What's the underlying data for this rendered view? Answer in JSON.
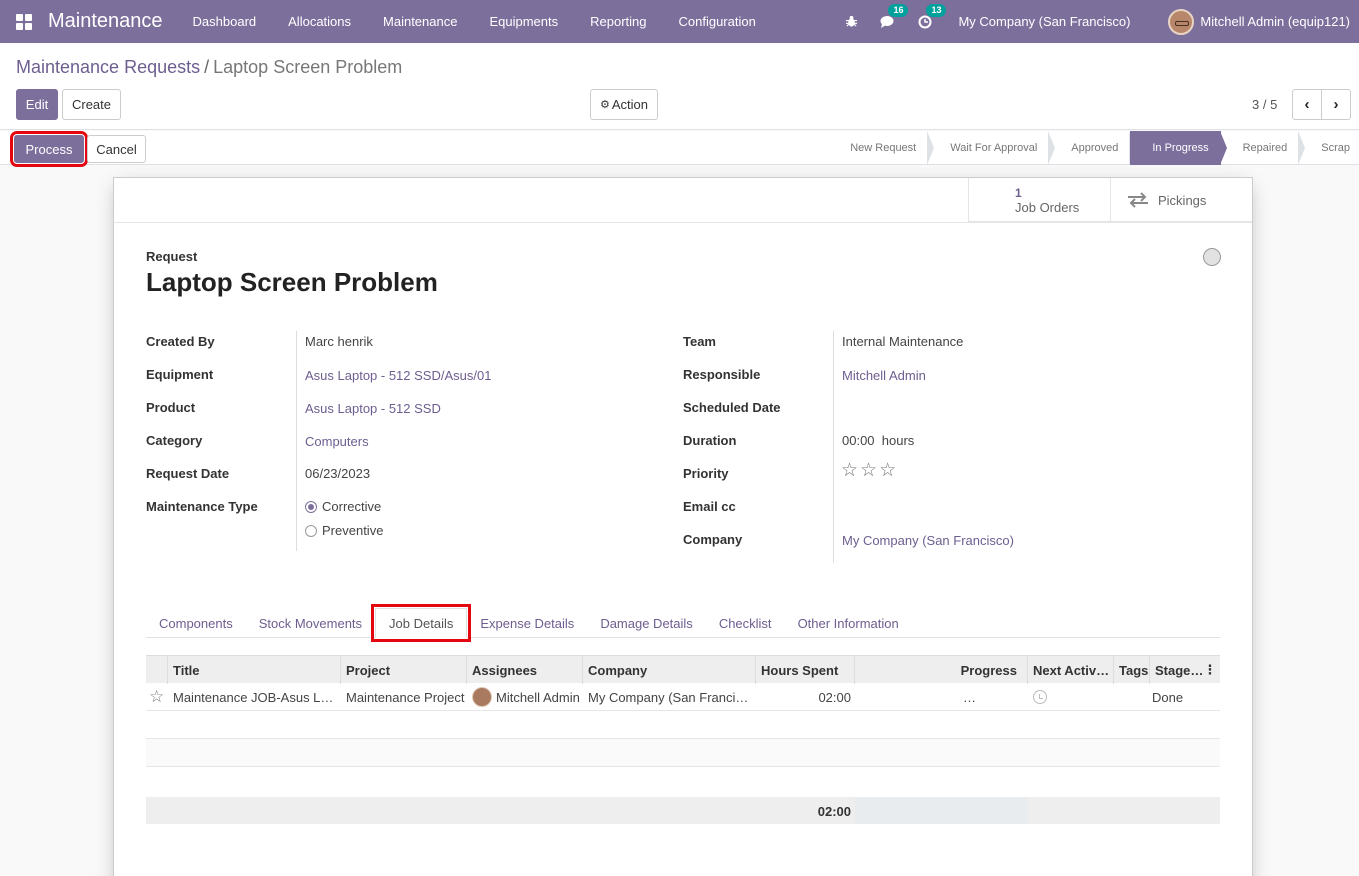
{
  "navbar": {
    "brand": "Maintenance",
    "menu": [
      "Dashboard",
      "Allocations",
      "Maintenance",
      "Equipments",
      "Reporting",
      "Configuration"
    ],
    "messages_count": "16",
    "activities_count": "13",
    "company": "My Company (San Francisco)",
    "user": "Mitchell Admin (equip121)"
  },
  "breadcrumb": {
    "parent": "Maintenance Requests",
    "separator": "/",
    "current": "Laptop Screen Problem"
  },
  "toolbar": {
    "edit": "Edit",
    "create": "Create",
    "action": "Action",
    "pager": "3 / 5"
  },
  "statusbar": {
    "process": "Process",
    "cancel": "Cancel",
    "stages": [
      "New Request",
      "Wait For Approval",
      "Approved",
      "In Progress",
      "Repaired",
      "Scrap"
    ],
    "active_stage": "In Progress"
  },
  "smart_buttons": {
    "job_orders_count": "1",
    "job_orders_label": "Job Orders",
    "pickings_label": "Pickings"
  },
  "form": {
    "request_label": "Request",
    "title": "Laptop Screen Problem",
    "left": {
      "created_by_label": "Created By",
      "created_by": "Marc henrik",
      "equipment_label": "Equipment",
      "equipment": "Asus Laptop - 512 SSD/Asus/01",
      "product_label": "Product",
      "product": "Asus Laptop - 512 SSD",
      "category_label": "Category",
      "category": "Computers",
      "request_date_label": "Request Date",
      "request_date": "06/23/2023",
      "maintenance_type_label": "Maintenance Type",
      "type_corrective": "Corrective",
      "type_preventive": "Preventive"
    },
    "right": {
      "team_label": "Team",
      "team": "Internal Maintenance",
      "responsible_label": "Responsible",
      "responsible": "Mitchell Admin",
      "scheduled_date_label": "Scheduled Date",
      "duration_label": "Duration",
      "duration": "00:00",
      "duration_unit": "hours",
      "priority_label": "Priority",
      "priority_stars": 0,
      "email_cc_label": "Email cc",
      "company_label": "Company",
      "company": "My Company (San Francisco)"
    }
  },
  "tabs": [
    "Components",
    "Stock Movements",
    "Job Details",
    "Expense Details",
    "Damage Details",
    "Checklist",
    "Other Information"
  ],
  "active_tab": "Job Details",
  "job_table": {
    "columns": [
      "Title",
      "Project",
      "Assignees",
      "Company",
      "Hours Spent",
      "Progress",
      "Next Activ…",
      "Tags",
      "Stage…"
    ],
    "rows": [
      {
        "title": "Maintenance JOB-Asus L…",
        "project": "Maintenance Project",
        "assignee": "Mitchell Admin",
        "company": "My Company (San Franci…",
        "hours": "02:00",
        "progress": "…",
        "stage": "Done"
      }
    ],
    "total_hours": "02:00"
  },
  "colors": {
    "primary": "#7c6f9c",
    "highlight": "#e5070f",
    "link": "#6e5e90"
  }
}
